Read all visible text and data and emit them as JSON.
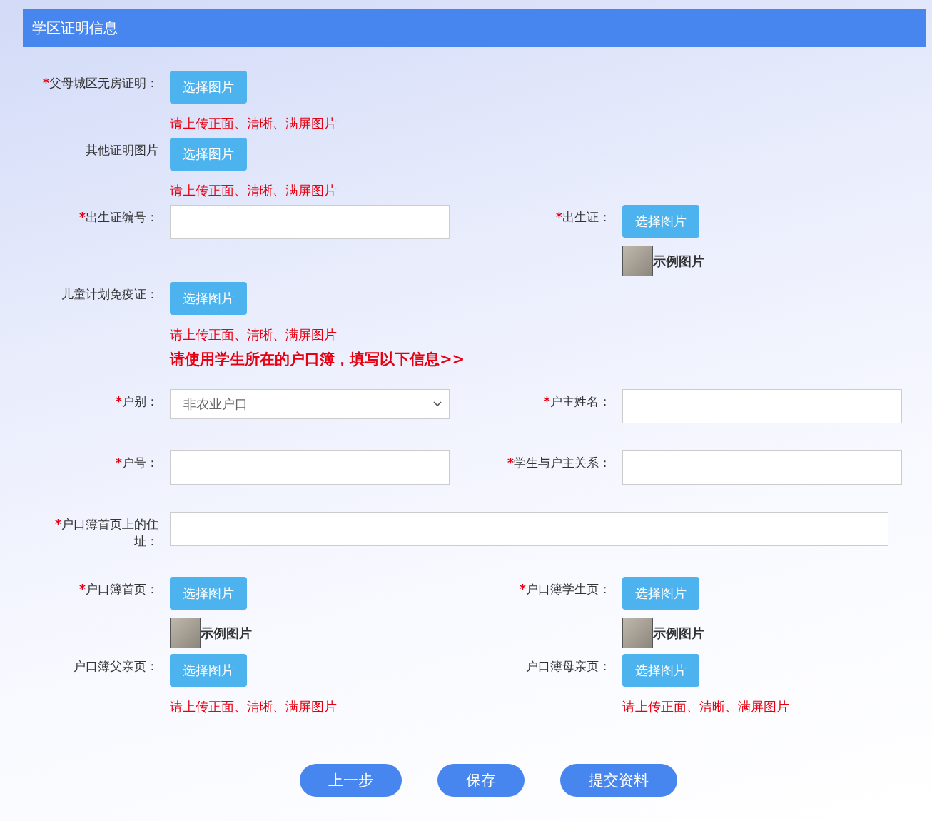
{
  "section": {
    "title": "学区证明信息"
  },
  "rows": [
    {
      "kind": "fields",
      "fields": [
        {
          "kind": "upload",
          "mark": "*",
          "label": "父母城区无房证明：",
          "button": "选择图片",
          "note": "请上传正面、清晰、满屏图片"
        }
      ]
    },
    {
      "kind": "fields",
      "fields": [
        {
          "kind": "upload",
          "label": "其他证明图片",
          "button": "选择图片",
          "note": "请上传正面、清晰、满屏图片"
        }
      ]
    },
    {
      "kind": "fields",
      "fields": [
        {
          "kind": "text",
          "mark": "*",
          "label": "出生证编号："
        },
        {
          "kind": "upload",
          "mark": "*",
          "label": "出生证：",
          "button": "选择图片",
          "sample": "示例图片"
        }
      ]
    },
    {
      "kind": "fields",
      "fields": [
        {
          "kind": "upload",
          "label": "儿童计划免疫证：",
          "button": "选择图片",
          "note": "请上传正面、清晰、满屏图片"
        }
      ]
    },
    {
      "kind": "notice",
      "text": "请使用学生所在的户口簿，填写以下信息>>"
    },
    {
      "kind": "fields",
      "fields": [
        {
          "kind": "select",
          "mark": "*",
          "label": "户别：",
          "value": "非农业户口"
        },
        {
          "kind": "text",
          "mark": "*",
          "label": "户主姓名："
        }
      ]
    },
    {
      "kind": "fields",
      "fields": [
        {
          "kind": "text",
          "mark": "*",
          "label": "户号："
        },
        {
          "kind": "text",
          "mark": "*",
          "label": "学生与户主关系："
        }
      ]
    },
    {
      "kind": "fields",
      "fields": [
        {
          "kind": "wide_text",
          "mark": "*",
          "label": "户口簿首页上的住址："
        }
      ]
    },
    {
      "kind": "fields",
      "fields": [
        {
          "kind": "upload",
          "mark": "*",
          "label": "户口簿首页：",
          "button": "选择图片",
          "sample": "示例图片"
        },
        {
          "kind": "upload",
          "mark": "*",
          "label": "户口簿学生页：",
          "button": "选择图片",
          "sample": "示例图片"
        }
      ]
    },
    {
      "kind": "fields",
      "fields": [
        {
          "kind": "upload",
          "label": "户口簿父亲页：",
          "button": "选择图片",
          "note": "请上传正面、清晰、满屏图片"
        },
        {
          "kind": "upload",
          "label": "户口簿母亲页：",
          "button": "选择图片",
          "note": "请上传正面、清晰、满屏图片"
        }
      ]
    }
  ],
  "actions": [
    {
      "label": "上一步"
    },
    {
      "label": "保存"
    },
    {
      "label": "提交资料"
    }
  ]
}
